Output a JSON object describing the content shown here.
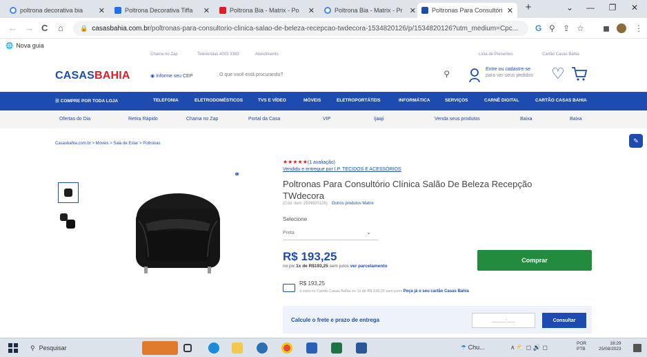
{
  "browser": {
    "tabs": [
      {
        "label": "poltrona decorativa bia",
        "favicon_color": "#4285f4",
        "active": false
      },
      {
        "label": "Poltrona Decorativa Tiffa",
        "favicon_color": "#1a73e8",
        "active": false
      },
      {
        "label": "Poltrona Bia - Matrix - Po",
        "favicon_color": "#e01b24",
        "active": false
      },
      {
        "label": "Poltrona Bia - Matrix - Pr",
        "favicon_color": "#4285f4",
        "active": false
      },
      {
        "label": "Poltronas Para Consultório",
        "favicon_color": "#1d4bb0",
        "active": true
      }
    ],
    "new_tab_label": "+",
    "window_controls": {
      "dropdown": "⌄",
      "minimize": "—",
      "restore": "❐",
      "close": "✕"
    },
    "nav": {
      "back": "←",
      "forward": "→",
      "reload": "C",
      "home": "⌂"
    },
    "url_domain": "casasbahia.com.br",
    "url_path": "/poltronas-para-consultorio-clinica-salao-de-beleza-recepcao-twdecora-1534820126/p/1534820126?utm_medium=Cpc...",
    "bookmark": "Nova guia"
  },
  "site": {
    "utility_left": [
      "Chama no Zap",
      "Televendas 4003 3383",
      "Atendimento"
    ],
    "utility_right": [
      "Lista de Presentes",
      "Cartão Casas Bahia"
    ],
    "logo_main": "CASAS",
    "logo_accent": "BAHIA",
    "cep_label": "Informe seu CEP",
    "search_placeholder": "O que você está procurando?",
    "account_line1": "Entre ou cadastre-se",
    "account_line2": "para ver seus pedidos",
    "categories": [
      "COMPRE POR TODA LOJA",
      "TELEFONIA",
      "ELETRODOMÉSTICOS",
      "TVS E VÍDEO",
      "MÓVEIS",
      "ELETROPORTÁTEIS",
      "INFORMÁTICA",
      "SERVIÇOS",
      "CARNÊ DIGITAL",
      "CARTÃO CASAS BAHIA"
    ],
    "subnav": [
      "Ofertas do Dia",
      "Retira Rápido",
      "Chama no Zap",
      "Portal da Casa",
      "VIP",
      "Ijaaji",
      "Venda seus produtos",
      "Baixa",
      "Baixa"
    ],
    "breadcrumb": "Casasbahia.com.br > Móveis > Sala de Estar > Poltronas"
  },
  "product": {
    "stars": "★★★★★",
    "reviews": "(1 avaliação)",
    "seller": "Vendido e entregue por I.P. TECIDOS E ACESSÓRIOS",
    "title": "Poltronas Para Consultório Clínica Salão De Beleza Recepção TWdecora",
    "code": "(Cód. item 1534820126)",
    "brand_link": "Outros produtos Matrix",
    "select_label": "Selecione",
    "select_value": "Preta",
    "price": "R$ 193,25",
    "installments_prefix": "no pix",
    "installments_bold": "1x de R$193,25",
    "installments_mid": "sem juros",
    "installments_link": "ver parcelamento",
    "buy_label": "Comprar",
    "card_price": "R$ 193,25",
    "card_info": "à vista no Cartão Casas Bahia ou 1x de R$ 193,25 sem juros",
    "card_link": "Peça já o seu cartão Casas Bahia",
    "freight_label": "Calcule o frete e prazo de entrega",
    "cep_placeholder": "_____-___",
    "consult_label": "Consultar"
  },
  "taskbar": {
    "search": "Pesquisar",
    "weather": "Chu...",
    "tray": "∧  ⛅  ◻  🔊  ◻",
    "lang_line1": "POR",
    "lang_line2": "PTB",
    "time": "18:29",
    "date": "25/08/2023"
  },
  "colors": {
    "brand_blue": "#1d4bb0",
    "brand_red": "#e01b24",
    "buy_green": "#238b3d"
  }
}
